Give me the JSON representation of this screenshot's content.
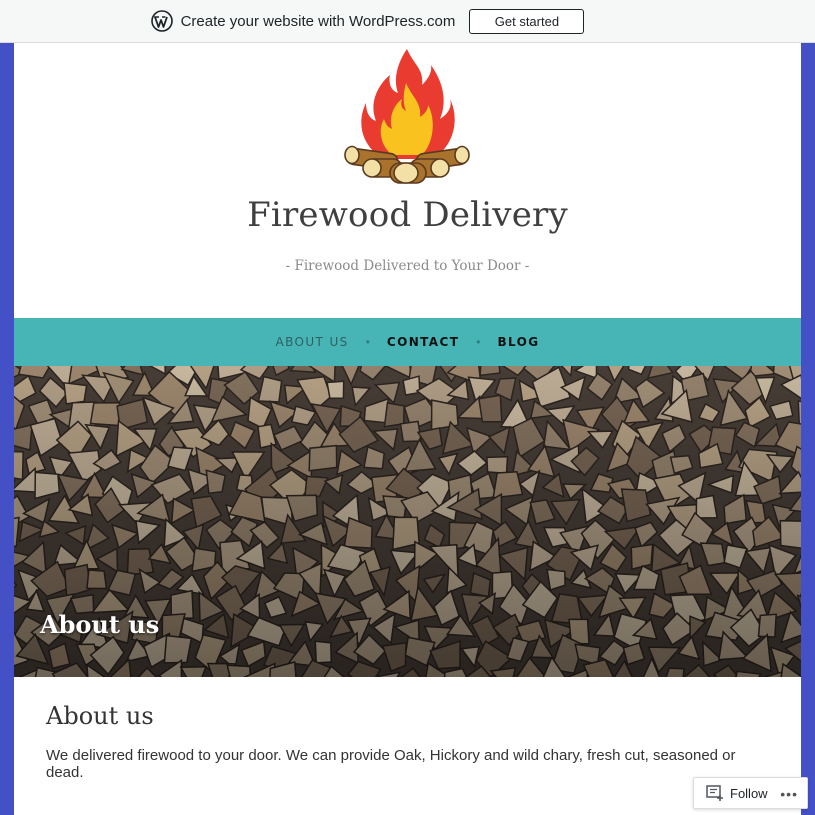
{
  "wpbar": {
    "text": "Create your website with WordPress.com",
    "button": "Get started"
  },
  "site": {
    "title": "Firewood Delivery",
    "description": "- Firewood Delivered to Your Door -"
  },
  "nav": {
    "items": [
      {
        "label": "ABOUT US",
        "current": true
      },
      {
        "label": "CONTACT",
        "current": false
      },
      {
        "label": "BLOG",
        "current": false
      }
    ]
  },
  "hero": {
    "title": "About us"
  },
  "entry": {
    "title": "About us",
    "text": "We delivered firewood to your door. We can provide Oak, Hickory and wild chary, fresh cut, seasoned or dead."
  },
  "follow": {
    "label": "Follow",
    "more": "•••"
  },
  "colors": {
    "frame": "#4450c6",
    "nav": "#47b5b6"
  }
}
